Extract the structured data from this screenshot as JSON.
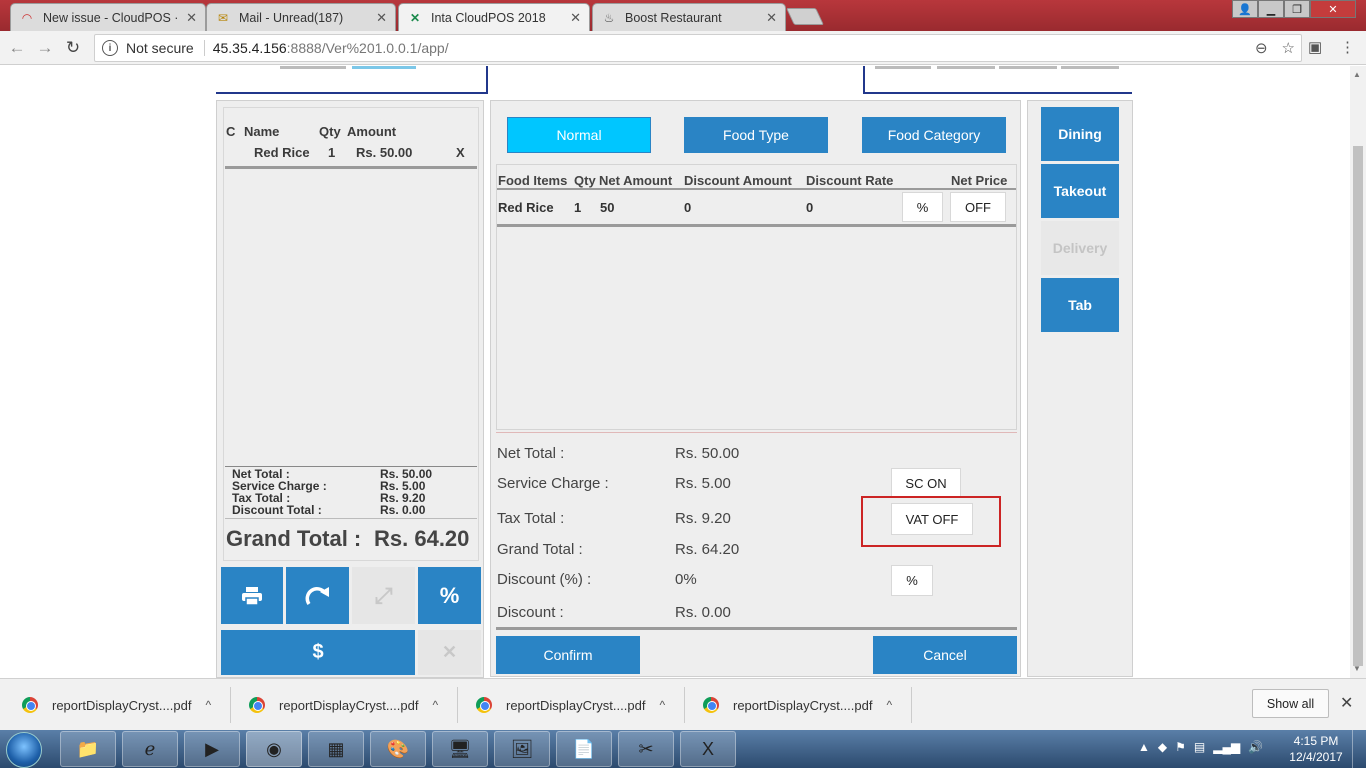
{
  "browser": {
    "tabs": [
      {
        "label": "New issue - CloudPOS · I",
        "icon": "redmine-icon"
      },
      {
        "label": "Mail - Unread(187)",
        "icon": "mail-icon"
      },
      {
        "label": "Inta CloudPOS 2018",
        "icon": "cloudpos-icon"
      },
      {
        "label": "Boost Restaurant",
        "icon": "restaurant-icon"
      }
    ],
    "security_label": "Not secure",
    "url_host": "45.35.4.156",
    "url_path": ":8888/Ver%201.0.0.1/app/"
  },
  "cart": {
    "headers": {
      "c": "C",
      "name": "Name",
      "qty": "Qty",
      "amount": "Amount"
    },
    "items": [
      {
        "name": "Red Rice",
        "qty": "1",
        "amount": "Rs. 50.00",
        "remove": "X"
      }
    ],
    "summary": {
      "net_total_label": "Net Total :",
      "net_total": "Rs. 50.00",
      "service_charge_label": "Service Charge :",
      "service_charge": "Rs. 5.00",
      "tax_total_label": "Tax Total :",
      "tax_total": "Rs. 9.20",
      "discount_total_label": "Discount Total :",
      "discount_total": "Rs. 0.00"
    },
    "grand_total_label": "Grand Total :",
    "grand_total": "Rs. 64.20",
    "buttons": {
      "percent": "%",
      "dollar": "$",
      "close": "✕"
    }
  },
  "order": {
    "type_buttons": {
      "normal": "Normal",
      "food_type": "Food Type",
      "food_category": "Food Category"
    },
    "columns": {
      "food_items": "Food Items",
      "qty": "Qty",
      "net_amount": "Net Amount",
      "discount_amount": "Discount Amount",
      "discount_rate": "Discount Rate",
      "net_price": "Net Price"
    },
    "items": [
      {
        "name": "Red Rice",
        "qty": "1",
        "net_amount": "50",
        "discount_amount": "0",
        "discount_rate": "0",
        "percent_btn": "%",
        "off_btn": "OFF"
      }
    ],
    "totals": {
      "net_total_label": "Net Total :",
      "net_total": "Rs. 50.00",
      "service_charge_label": "Service Charge :",
      "service_charge": "Rs. 5.00",
      "tax_total_label": "Tax Total :",
      "tax_total": "Rs. 9.20",
      "grand_total_label": "Grand Total :",
      "grand_total": "Rs. 64.20",
      "discount_pct_label": "Discount (%) :",
      "discount_pct": "0%",
      "discount_label": "Discount :",
      "discount": "Rs. 0.00"
    },
    "toggles": {
      "sc": "SC ON",
      "vat": "VAT OFF",
      "percent": "%"
    },
    "confirm": "Confirm",
    "cancel": "Cancel"
  },
  "modes": {
    "dining": "Dining",
    "takeout": "Takeout",
    "delivery": "Delivery",
    "tab": "Tab"
  },
  "downloads": {
    "items": [
      "reportDisplayCryst....pdf",
      "reportDisplayCryst....pdf",
      "reportDisplayCryst....pdf",
      "reportDisplayCryst....pdf"
    ],
    "show_all": "Show all"
  },
  "taskbar": {
    "time": "4:15 PM",
    "date": "12/4/2017"
  },
  "colors": {
    "accent_blue": "#2a84c5",
    "normal_cyan": "#00c6ff",
    "highlight_red": "#cc2424"
  }
}
